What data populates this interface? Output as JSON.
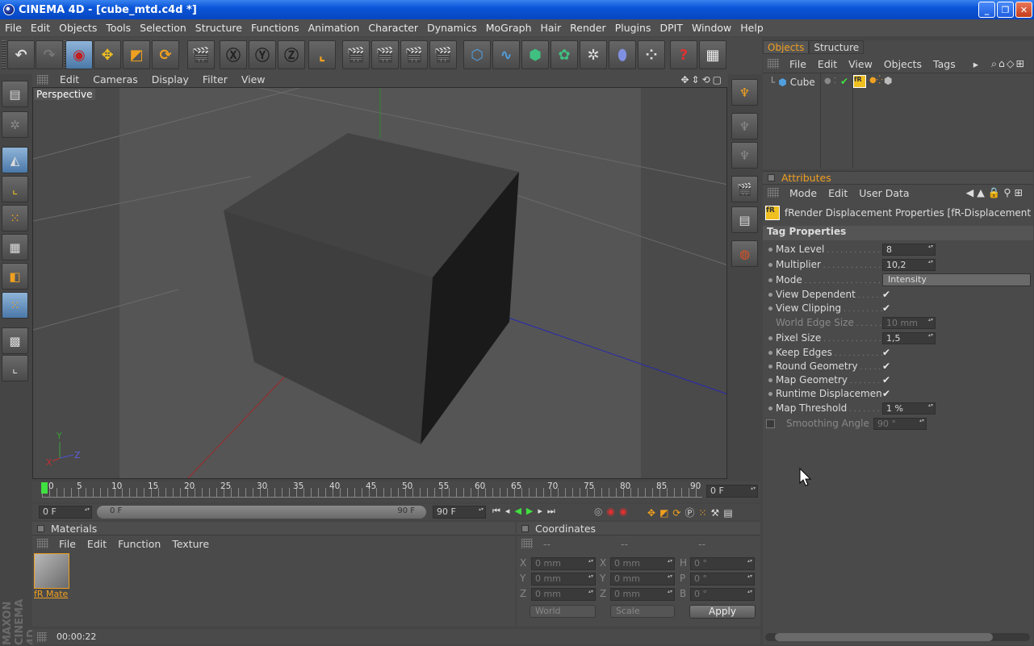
{
  "window": {
    "title": "CINEMA 4D - [cube_mtd.c4d *]"
  },
  "menubar": [
    "File",
    "Edit",
    "Objects",
    "Tools",
    "Selection",
    "Structure",
    "Functions",
    "Animation",
    "Character",
    "Dynamics",
    "MoGraph",
    "Hair",
    "Render",
    "Plugins",
    "DPIT",
    "Window",
    "Help"
  ],
  "viewport": {
    "menu": [
      "Edit",
      "Cameras",
      "Display",
      "Filter",
      "View"
    ],
    "label": "Perspective",
    "axis": {
      "x": "X",
      "y": "Y",
      "z": "Z"
    }
  },
  "timeline": {
    "ticks": [
      "0",
      "5",
      "10",
      "15",
      "20",
      "25",
      "30",
      "35",
      "40",
      "45",
      "50",
      "55",
      "60",
      "65",
      "70",
      "75",
      "80",
      "85",
      "90"
    ],
    "current": "0 F",
    "start": "0 F",
    "range_start": "0 F",
    "range_end": "90 F",
    "end": "90 F"
  },
  "materials": {
    "title": "Materials",
    "menu": [
      "File",
      "Edit",
      "Function",
      "Texture"
    ],
    "items": [
      {
        "name": "fR Mate"
      }
    ]
  },
  "coordinates": {
    "title": "Coordinates",
    "headers": [
      "--",
      "--",
      "--"
    ],
    "rows": [
      {
        "a": "X",
        "av": "0 mm",
        "b": "X",
        "bv": "0 mm",
        "c": "H",
        "cv": "0 °"
      },
      {
        "a": "Y",
        "av": "0 mm",
        "b": "Y",
        "bv": "0 mm",
        "c": "P",
        "cv": "0 °"
      },
      {
        "a": "Z",
        "av": "0 mm",
        "b": "Z",
        "bv": "0 mm",
        "c": "B",
        "cv": "0 °"
      }
    ],
    "mode1": "World",
    "mode2": "Scale",
    "apply": "Apply"
  },
  "status": {
    "time": "00:00:22"
  },
  "objects_panel": {
    "tabs": [
      "Objects",
      "Structure"
    ],
    "menu": [
      "File",
      "Edit",
      "View",
      "Objects",
      "Tags"
    ],
    "items": [
      {
        "name": "Cube"
      }
    ]
  },
  "attributes": {
    "title": "Attributes",
    "menu": [
      "Mode",
      "Edit",
      "User Data"
    ],
    "header": "fRender Displacement Properties [fR-Displacement Ta",
    "section": "Tag Properties",
    "props": [
      {
        "label": "Max Level",
        "type": "num",
        "value": "8"
      },
      {
        "label": "Multiplier",
        "type": "num",
        "value": "10,2"
      },
      {
        "label": "Mode",
        "type": "select",
        "value": "Intensity"
      },
      {
        "label": "View Dependent",
        "type": "check",
        "value": "✔"
      },
      {
        "label": "View Clipping",
        "type": "check",
        "value": "✔"
      },
      {
        "label": "World Edge Size",
        "type": "num",
        "value": "10 mm",
        "dim": true
      },
      {
        "label": "Pixel Size",
        "type": "num",
        "value": "1,5"
      },
      {
        "label": "Keep Edges",
        "type": "check",
        "value": "✔"
      },
      {
        "label": "Round Geometry",
        "type": "check",
        "value": "✔"
      },
      {
        "label": "Map Geometry",
        "type": "check",
        "value": "✔"
      },
      {
        "label": "Runtime Displacement",
        "type": "check",
        "value": "✔"
      },
      {
        "label": "Map Threshold",
        "type": "num",
        "value": "1 %"
      },
      {
        "label": "Smoothing Angle",
        "type": "num",
        "value": "90 °",
        "dim": true
      }
    ]
  }
}
